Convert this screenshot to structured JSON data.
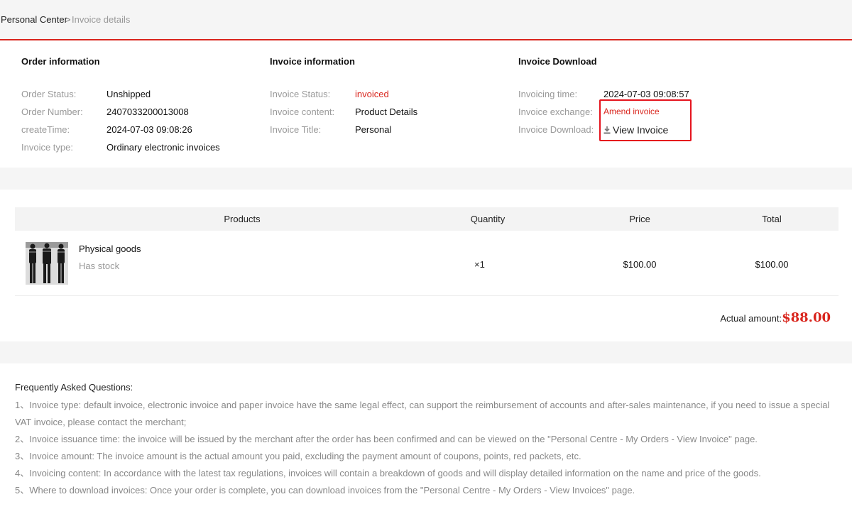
{
  "breadcrumb": {
    "home": "Personal Center",
    "separator": ">",
    "current": "Invoice details"
  },
  "order_info": {
    "title": "Order information",
    "rows": [
      {
        "label": "Order Status:",
        "value": "Unshipped"
      },
      {
        "label": "Order Number:",
        "value": "2407033200013008"
      },
      {
        "label": "createTime:",
        "value": "2024-07-03 09:08:26"
      },
      {
        "label": "Invoice type:",
        "value": "Ordinary electronic invoices"
      }
    ]
  },
  "invoice_info": {
    "title": "Invoice information",
    "rows": [
      {
        "label": "Invoice Status:",
        "value": "invoiced"
      },
      {
        "label": "Invoice content:",
        "value": "Product Details"
      },
      {
        "label": "Invoice Title:",
        "value": "Personal"
      }
    ]
  },
  "invoice_download": {
    "title": "Invoice Download",
    "time_label": "Invoicing time:",
    "time_value": "2024-07-03 09:08:57",
    "exchange_label": "Invoice exchange:",
    "exchange_link": "Amend invoice",
    "download_label": "Invoice Download:",
    "download_link": "View Invoice",
    "download_icon": "download-icon"
  },
  "products": {
    "headers": [
      "Products",
      "Quantity",
      "Price",
      "Total"
    ],
    "items": [
      {
        "name": "Physical goods",
        "stock": "Has stock",
        "quantity": "×1",
        "price": "$100.00",
        "total": "$100.00",
        "thumbnail": "clothing-thumbnail"
      }
    ],
    "actual_label": "Actual amount:",
    "actual_value": "$88.00"
  },
  "faq": {
    "title": "Frequently Asked Questions:",
    "items": [
      "1、Invoice type: default invoice, electronic invoice and paper invoice have the same legal effect, can support the reimbursement of accounts and after-sales maintenance, if you need to issue a special VAT invoice, please contact the merchant;",
      "2、Invoice issuance time: the invoice will be issued by the merchant after the order has been confirmed and can be viewed on the \"Personal Centre - My Orders - View Invoice\" page.",
      "3、Invoice amount: The invoice amount is the actual amount you paid, excluding the payment amount of coupons, points, red packets, etc.",
      "4、Invoicing content: In accordance with the latest tax regulations, invoices will contain a breakdown of goods and will display detailed information on the name and price of the goods.",
      "5、Where to download invoices: Once your order is complete, you can download invoices from the \"Personal Centre - My Orders - View Invoices\" page."
    ]
  },
  "colors": {
    "accent": "#d9251d",
    "highlight_box": "#e5131d"
  }
}
